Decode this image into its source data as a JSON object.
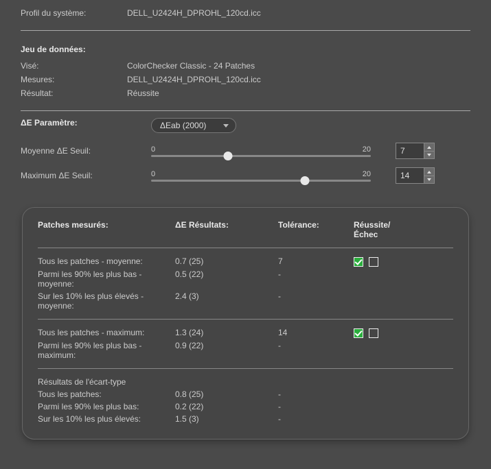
{
  "profile": {
    "label": "Profil du système:",
    "value": "DELL_U2424H_DPROHL_120cd.icc"
  },
  "dataset": {
    "heading": "Jeu de données:",
    "target_label": "Visé:",
    "target_value": "ColorChecker Classic - 24 Patches",
    "measures_label": "Mesures:",
    "measures_value": "DELL_U2424H_DPROHL_120cd.icc",
    "result_label": "Résultat:",
    "result_value": "Réussite"
  },
  "de_param": {
    "label": "ΔE Paramètre:",
    "selected": "ΔEab (2000)"
  },
  "sliders": {
    "min": "0",
    "max": "20",
    "avg_label": "Moyenne ΔE Seuil:",
    "avg_value": "7",
    "avg_pos_pct": "35",
    "max_label": "Maximum ΔE Seuil:",
    "max_value": "14",
    "max_pos_pct": "70"
  },
  "table": {
    "headers": {
      "patch": "Patches mesurés:",
      "de": "ΔE Résultats:",
      "tol": "Tolérance:",
      "pass": "Réussite/ Échec"
    },
    "group1": {
      "r1_patch": "Tous les patches - moyenne:",
      "r1_de": "0.7 (25)",
      "r1_tol": "7",
      "r2_patch": "Parmi les 90% les plus bas - moyenne:",
      "r2_de": "0.5 (22)",
      "r2_tol": "-",
      "r3_patch": "Sur les 10% les plus élevés - moyenne:",
      "r3_de": "2.4 (3)",
      "r3_tol": "-"
    },
    "group2": {
      "r1_patch": "Tous les patches - maximum:",
      "r1_de": "1.3 (24)",
      "r1_tol": "14",
      "r2_patch": "Parmi les 90% les plus bas - maximum:",
      "r2_de": "0.9 (22)",
      "r2_tol": "-"
    },
    "group3": {
      "heading": "Résultats de l'écart-type",
      "r1_patch": "Tous les patches:",
      "r1_de": "0.8 (25)",
      "r1_tol": "-",
      "r2_patch": "Parmi les 90% les plus bas:",
      "r2_de": "0.2 (22)",
      "r2_tol": "-",
      "r3_patch": "Sur les 10% les plus élevés:",
      "r3_de": "1.5 (3)",
      "r3_tol": "-"
    }
  }
}
